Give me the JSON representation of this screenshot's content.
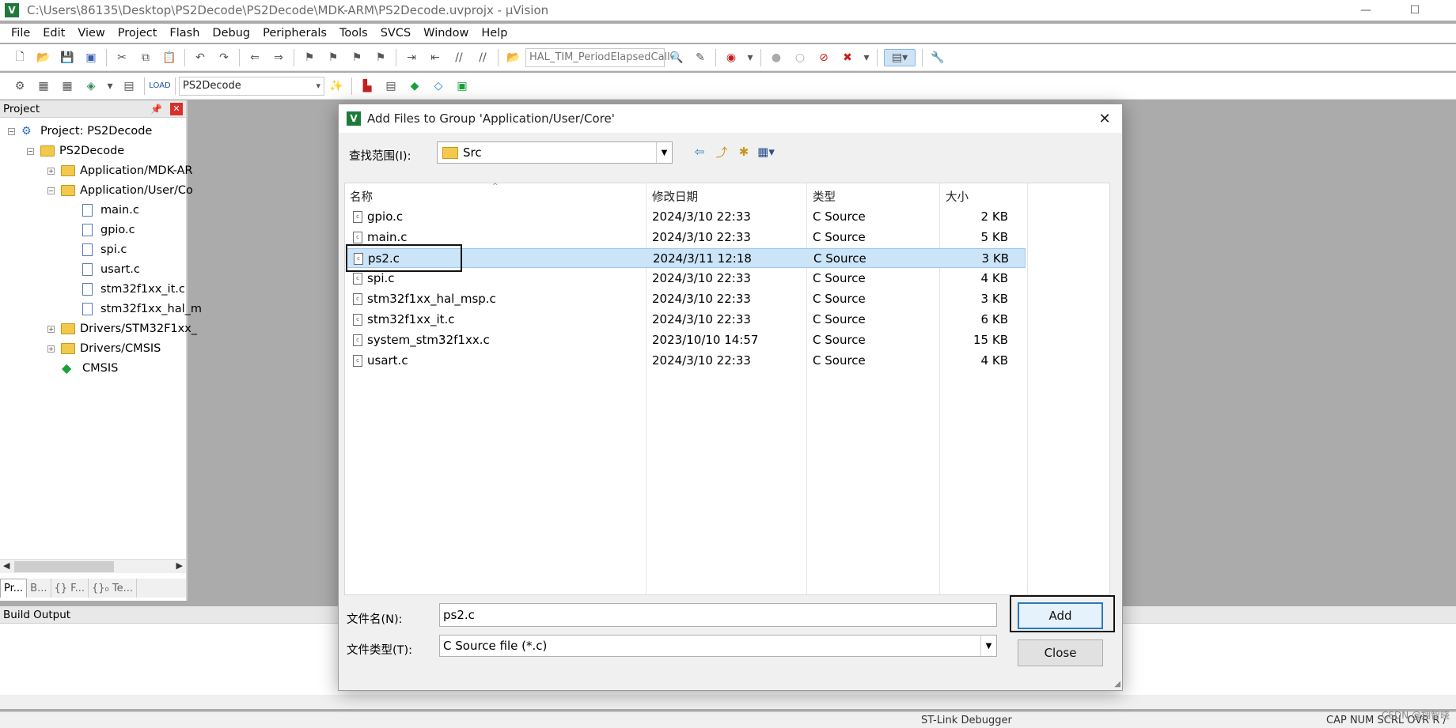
{
  "window": {
    "title": "C:\\Users\\86135\\Desktop\\PS2Decode\\PS2Decode\\MDK-ARM\\PS2Decode.uvprojx - µVision",
    "minimize": "—",
    "maximize": "☐"
  },
  "menu": [
    "File",
    "Edit",
    "View",
    "Project",
    "Flash",
    "Debug",
    "Peripherals",
    "Tools",
    "SVCS",
    "Window",
    "Help"
  ],
  "toolbar": {
    "function_combo": "HAL_TIM_PeriodElapsedCall",
    "target_combo": "PS2Decode"
  },
  "project_panel": {
    "title": "Project",
    "tree": {
      "root": "Project: PS2Decode",
      "target": "PS2Decode",
      "groups": [
        {
          "label": "Application/MDK-AR"
        },
        {
          "label": "Application/User/Co"
        }
      ],
      "files": [
        "main.c",
        "gpio.c",
        "spi.c",
        "usart.c",
        "stm32f1xx_it.c",
        "stm32f1xx_hal_m"
      ],
      "groups2": [
        {
          "label": "Drivers/STM32F1xx_"
        },
        {
          "label": "Drivers/CMSIS"
        }
      ],
      "cmsis": "CMSIS"
    },
    "tabs": [
      "Pr...",
      "B...",
      "{} F...",
      "{}₀ Te..."
    ]
  },
  "build_output": {
    "title": "Build Output"
  },
  "status": {
    "debugger": "ST-Link Debugger",
    "indicators": "CAP  NUM  SCRL  OVR  R /"
  },
  "dialog": {
    "title": "Add Files to Group 'Application/User/Core'",
    "look_in_label": "查找范围(I):",
    "look_in_value": "Src",
    "columns": {
      "name": "名称",
      "date": "修改日期",
      "type": "类型",
      "size": "大小"
    },
    "files": [
      {
        "name": "gpio.c",
        "date": "2024/3/10 22:33",
        "type": "C Source",
        "size": "2 KB"
      },
      {
        "name": "main.c",
        "date": "2024/3/10 22:33",
        "type": "C Source",
        "size": "5 KB"
      },
      {
        "name": "ps2.c",
        "date": "2024/3/11 12:18",
        "type": "C Source",
        "size": "3 KB"
      },
      {
        "name": "spi.c",
        "date": "2024/3/10 22:33",
        "type": "C Source",
        "size": "4 KB"
      },
      {
        "name": "stm32f1xx_hal_msp.c",
        "date": "2024/3/10 22:33",
        "type": "C Source",
        "size": "3 KB"
      },
      {
        "name": "stm32f1xx_it.c",
        "date": "2024/3/10 22:33",
        "type": "C Source",
        "size": "6 KB"
      },
      {
        "name": "system_stm32f1xx.c",
        "date": "2023/10/10 14:57",
        "type": "C Source",
        "size": "15 KB"
      },
      {
        "name": "usart.c",
        "date": "2024/3/10 22:33",
        "type": "C Source",
        "size": "4 KB"
      }
    ],
    "selected_index": 2,
    "filename_label": "文件名(N):",
    "filename_value": "ps2.c",
    "filetype_label": "文件类型(T):",
    "filetype_value": "C Source file (*.c)",
    "add_button": "Add",
    "close_button": "Close"
  },
  "watermark": "CSDN @翔智晓"
}
